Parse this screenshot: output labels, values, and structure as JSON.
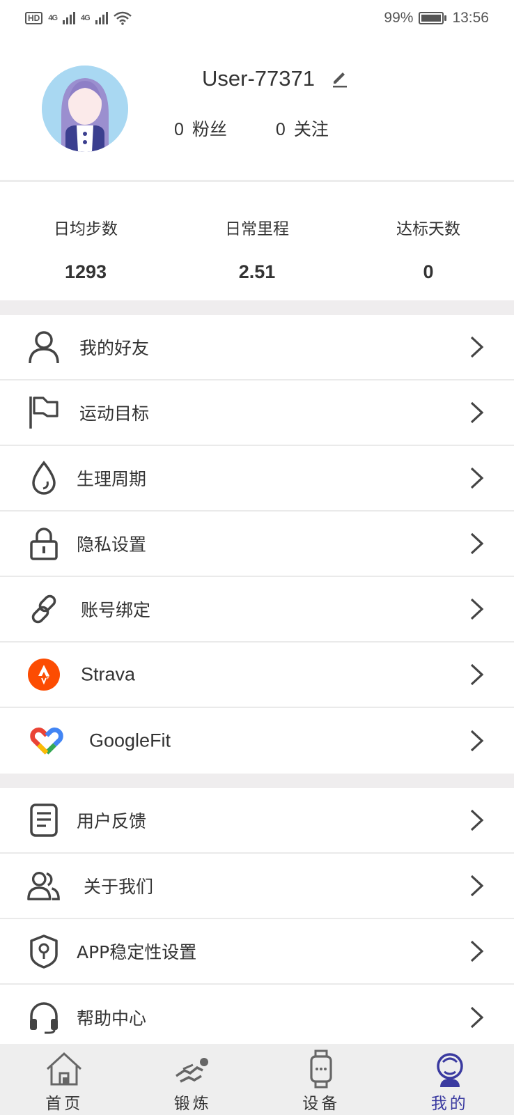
{
  "status_bar": {
    "hd": "HD",
    "sig1": "4G",
    "sig2": "4G",
    "battery": "99%",
    "time": "13:56"
  },
  "profile": {
    "username": "User-77371",
    "fans_count": "0",
    "fans_label": "粉丝",
    "following_count": "0",
    "following_label": "关注"
  },
  "stats": [
    {
      "label": "日均步数",
      "value": "1293"
    },
    {
      "label": "日常里程",
      "value": "2.51"
    },
    {
      "label": "达标天数",
      "value": "0"
    }
  ],
  "menu_group1": [
    {
      "label": "我的好友",
      "icon": "user-icon"
    },
    {
      "label": "运动目标",
      "icon": "flag-icon"
    },
    {
      "label": "生理周期",
      "icon": "drop-icon"
    },
    {
      "label": "隐私设置",
      "icon": "lock-icon"
    },
    {
      "label": "账号绑定",
      "icon": "link-icon"
    },
    {
      "label": "Strava",
      "icon": "strava-icon"
    },
    {
      "label": "GoogleFit",
      "icon": "googlefit-icon"
    }
  ],
  "menu_group2": [
    {
      "label": "用户反馈",
      "icon": "document-icon"
    },
    {
      "label": "关于我们",
      "icon": "people-icon"
    },
    {
      "label": "APP稳定性设置",
      "icon": "shield-icon"
    },
    {
      "label": "帮助中心",
      "icon": "headset-icon"
    }
  ],
  "tabs": [
    {
      "label": "首页",
      "icon": "home-icon"
    },
    {
      "label": "锻炼",
      "icon": "runner-icon"
    },
    {
      "label": "设备",
      "icon": "watch-icon"
    },
    {
      "label": "我的",
      "icon": "profile-icon",
      "active": true
    }
  ],
  "colors": {
    "accent": "#3a3aa0",
    "strava": "#fc4c02",
    "band": "#efedee"
  }
}
